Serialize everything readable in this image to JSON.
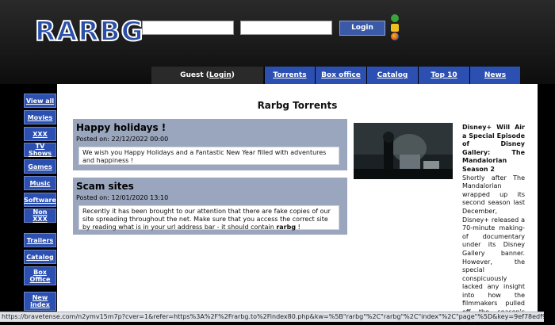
{
  "logo": {
    "text": "RARBG"
  },
  "header": {
    "username_value": "",
    "password_value": "",
    "login_button": "Login"
  },
  "tabs": {
    "guest_prefix": "Guest (",
    "guest_link": "Login",
    "guest_suffix": ")",
    "items": [
      "Torrents",
      "Box office",
      "Catalog",
      "Top 10",
      "News"
    ]
  },
  "sidebar": {
    "items": [
      "View all",
      "Movies",
      "XXX",
      "TV Shows",
      "Games",
      "Music",
      "Software",
      "Non XXX",
      "Trailers",
      "Catalog",
      "Box Office",
      "New index"
    ]
  },
  "main": {
    "title": "Rarbg Torrents",
    "news": [
      {
        "title": "Happy holidays !",
        "date": "Posted on: 22/12/2022 00:00",
        "body": "We wish you Happy Holidays and a Fantastic New Year filled with adventures and happiness !"
      },
      {
        "title": "Scam sites",
        "date": "Posted on: 12/01/2020 13:10",
        "body_start": "Recently it has been brought to our attention that there are fake copies of our site spreading throughout the net. Make sure that you access the correct site by reading what is in your url address bar - it should contain ",
        "body_bold": "rarbg",
        "body_end": " !"
      }
    ],
    "article": {
      "headline": "Disney+ Will Air a Special Episode of Disney Gallery: The Mandalorian Season 2",
      "text": "Shortly after The Mandalorian wrapped up its second season last December, Disney+ released a 70-minute making-of documentary under its Disney Gallery banner. However, the special conspicuously lacked any insight into how the filmmakers pulled off the season's biggest reveal."
    }
  },
  "status_bar": {
    "url": "https://bravetense.com/n2ymv15m7p?cver=1&refer=https%3A%2F%2Frarbg.to%2Findex80.php&kw=%5B\"rarbg\"%2C\"rarbg\"%2C\"index\"%2C\"page\"%5D&key=9ef78edf998c4df1e..."
  },
  "colors": {
    "accent_blue": "#2b50b1",
    "news_panel": "#9aa6bd"
  },
  "icons": [
    "utorrent-icon",
    "star-icon",
    "firefox-icon"
  ]
}
